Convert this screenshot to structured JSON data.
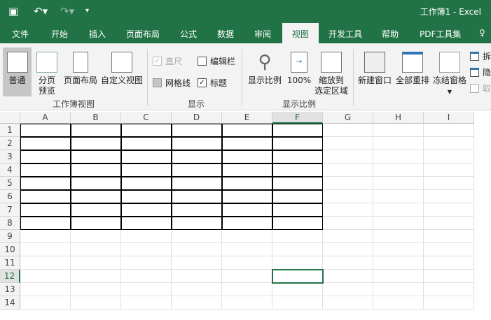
{
  "titlebar": {
    "save_icon": "save-icon",
    "undo_icon": "undo-icon",
    "redo_icon": "redo-icon",
    "customize_icon": "dropdown-icon",
    "doc_title": "工作簿1  -  Excel"
  },
  "tabs": [
    "文件",
    "开始",
    "插入",
    "页面布局",
    "公式",
    "数据",
    "审阅",
    "视图",
    "开发工具",
    "帮助",
    "PDF工具集"
  ],
  "active_tab": "视图",
  "ribbon": {
    "workbook_views": {
      "label": "工作簿视图",
      "normal": "普通",
      "page_break_1": "分页",
      "page_break_2": "预览",
      "page_layout": "页面布局",
      "custom_views": "自定义视图"
    },
    "show": {
      "label": "显示",
      "ruler": "直尺",
      "ruler_checked": true,
      "formula_bar": "编辑栏",
      "formula_bar_checked": false,
      "gridlines": "网格线",
      "gridlines_checked": false,
      "headings": "标题",
      "headings_checked": true
    },
    "zoom": {
      "label": "显示比例",
      "zoom": "显示比例",
      "zoom100": "100%",
      "zoom_sel_1": "缩放到",
      "zoom_sel_2": "选定区域"
    },
    "window": {
      "new_window": "新建窗口",
      "arrange_all": "全部重排",
      "freeze": "冻结窗格",
      "split": "拆",
      "hide": "隐",
      "unhide": "取"
    }
  },
  "sheet": {
    "columns": [
      "A",
      "B",
      "C",
      "D",
      "E",
      "F",
      "G",
      "H",
      "I"
    ],
    "rows": [
      "1",
      "2",
      "3",
      "4",
      "5",
      "6",
      "7",
      "8",
      "9",
      "10",
      "11",
      "12",
      "13",
      "14"
    ],
    "selected_cell": "F12",
    "accent": "#217346"
  }
}
